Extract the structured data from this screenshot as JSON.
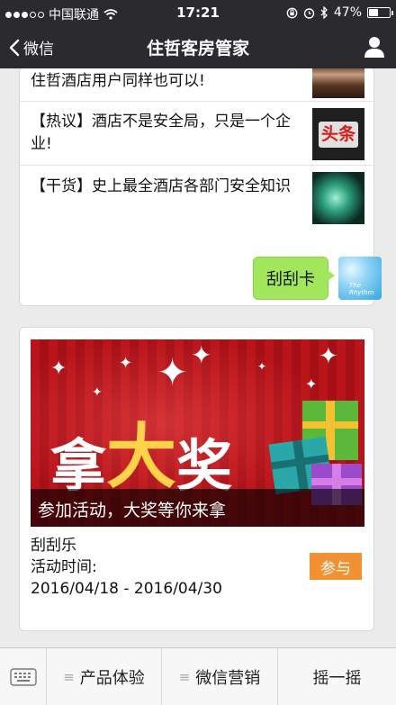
{
  "status_bar": {
    "carrier": "中国联通",
    "time": "17:21",
    "battery": "47%",
    "battery_level": 0.47
  },
  "nav": {
    "back_label": "微信",
    "title": "住哲客房管家"
  },
  "news": [
    {
      "title": "住哲酒店用户同样也可以!"
    },
    {
      "title": "【热议】酒店不是安全局，只是一个企业!",
      "thumb_text": "头条"
    },
    {
      "title": "【干货】史上最全酒店各部门安全知识"
    }
  ],
  "message": {
    "text": "刮刮卡"
  },
  "promo": {
    "banner_chars": [
      "拿",
      "大",
      "奖"
    ],
    "banner_caption": "参加活动，大奖等你来拿",
    "name": "刮刮乐",
    "time_label": "活动时间:",
    "time_range": "2016/04/18 - 2016/04/30",
    "join_label": "参与"
  },
  "bottom_menu": {
    "items": [
      {
        "label": "产品体验"
      },
      {
        "label": "微信营销"
      },
      {
        "label": "摇一摇"
      }
    ]
  },
  "colors": {
    "bar_dark": "#2b2b2f",
    "bubble_green": "#a2e65b",
    "join_orange": "#f29132",
    "banner_red": "#b8141a"
  },
  "icons": [
    "signal-dots-icon",
    "wifi-icon",
    "lock-rotation-icon",
    "alarm-icon",
    "bluetooth-icon",
    "battery-icon",
    "back-chevron-icon",
    "user-icon",
    "keyboard-icon",
    "menu-lines-icon"
  ]
}
